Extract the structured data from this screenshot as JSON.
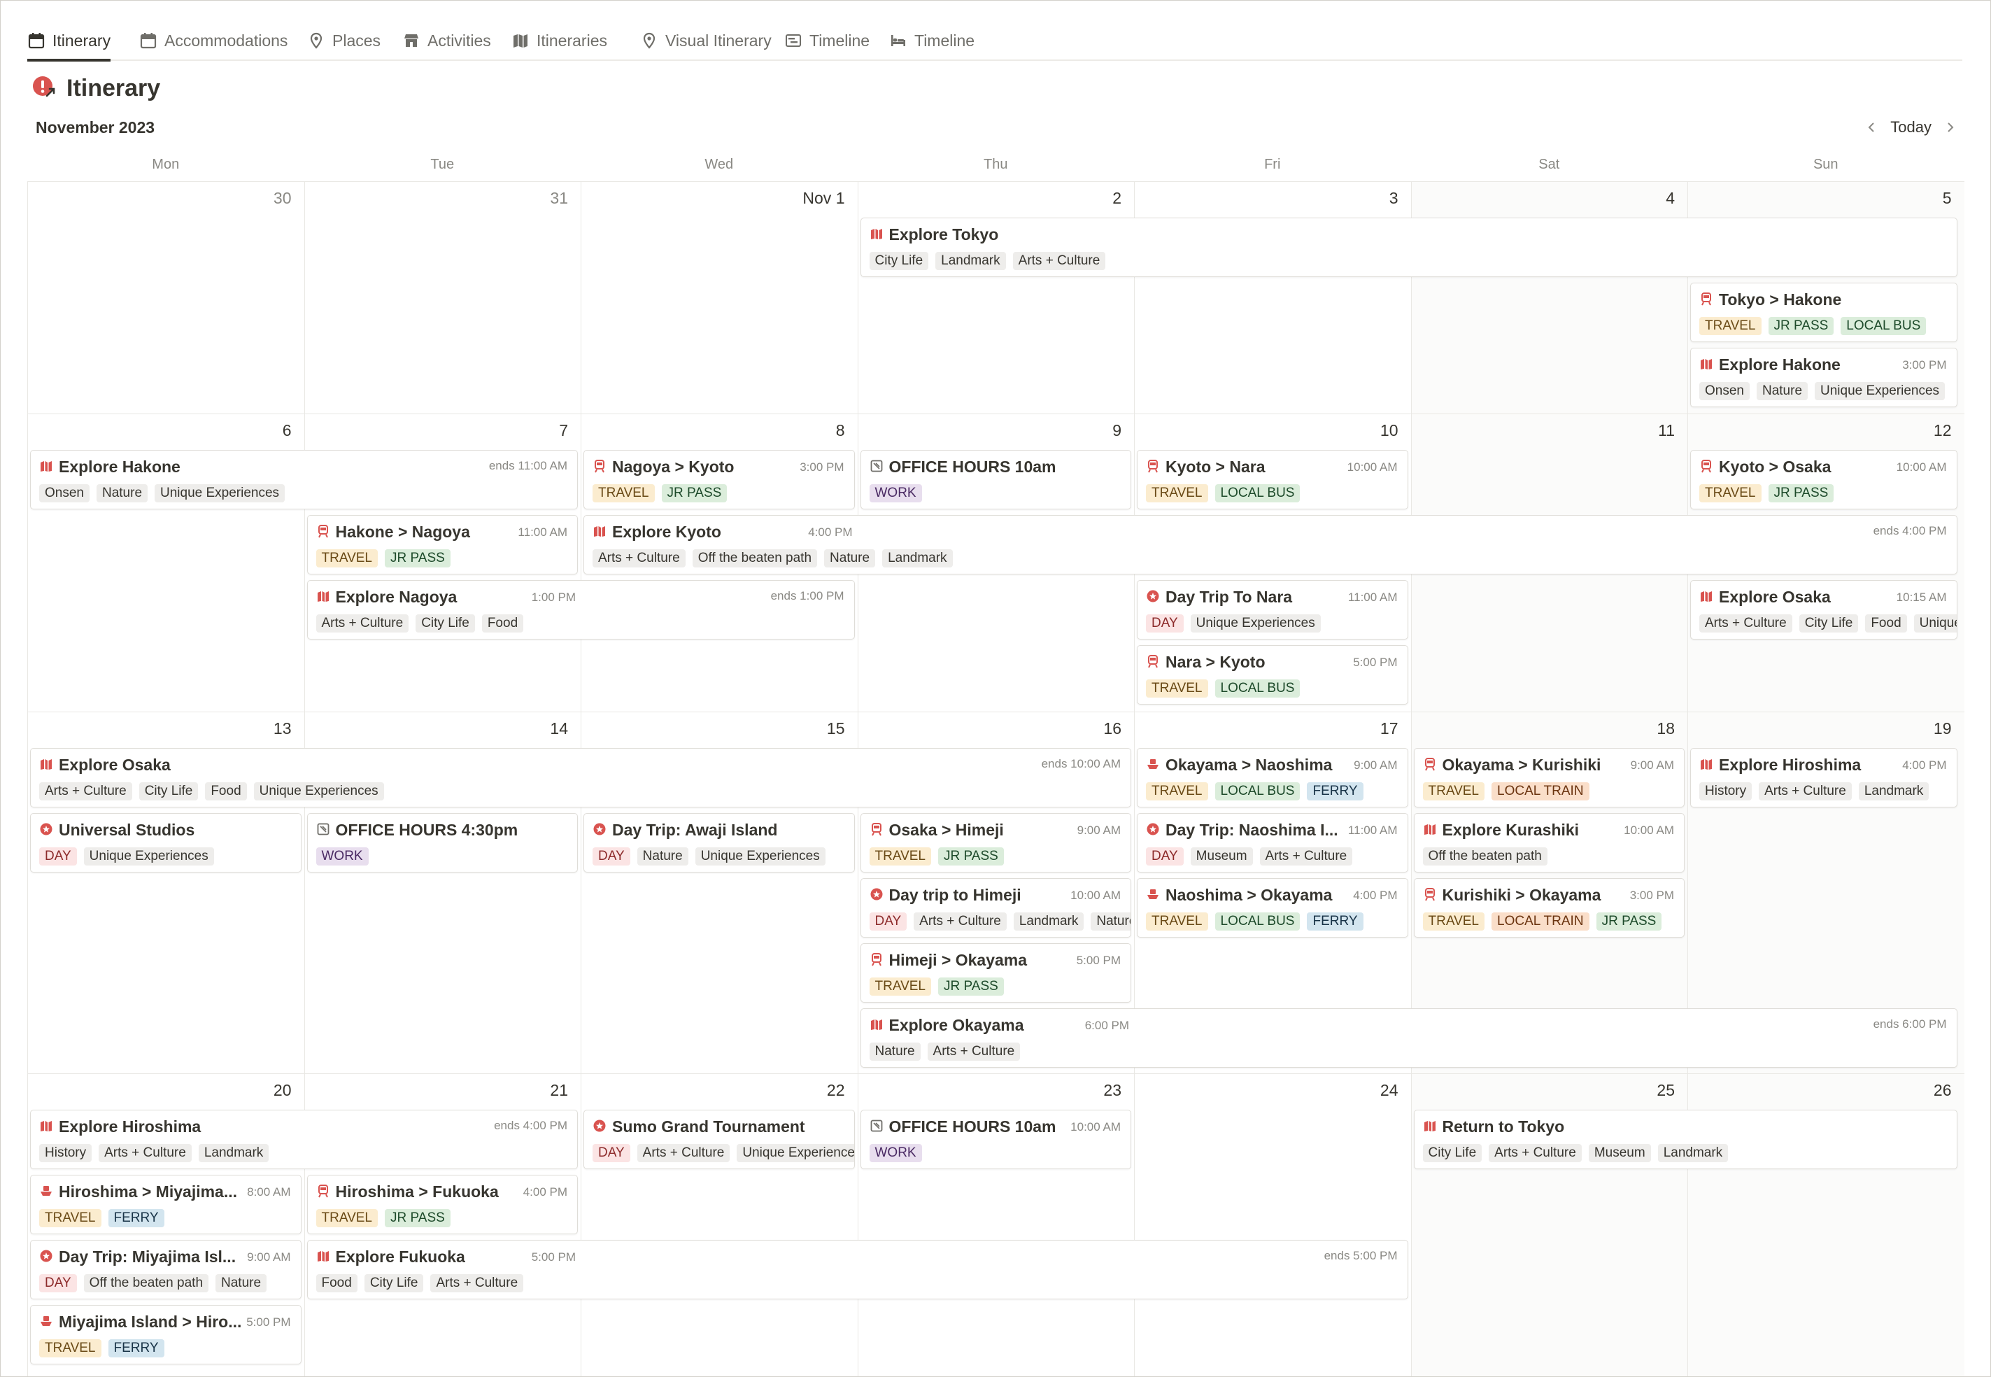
{
  "tabs": [
    {
      "label": "Itinerary",
      "icon": "calendar-icon",
      "active": true
    },
    {
      "label": "Accommodations",
      "icon": "calendar-icon",
      "active": false
    },
    {
      "label": "Places",
      "icon": "map-pin-icon",
      "active": false
    },
    {
      "label": "Activities",
      "icon": "store-icon",
      "active": false
    },
    {
      "label": "Itineraries",
      "icon": "map-icon",
      "active": false
    },
    {
      "label": "Visual Itinerary",
      "icon": "map-pin-icon",
      "active": false
    },
    {
      "label": "Timeline",
      "icon": "timeline-icon",
      "active": false
    },
    {
      "label": "Timeline",
      "icon": "bed-icon",
      "active": false
    }
  ],
  "page": {
    "title": "Itinerary",
    "icon": "info-alert-icon"
  },
  "calendar": {
    "month_label": "November 2023",
    "today_label": "Today",
    "weekdays": [
      "Mon",
      "Tue",
      "Wed",
      "Thu",
      "Fri",
      "Sat",
      "Sun"
    ],
    "weeks": [
      [
        "30",
        "31",
        "Nov 1",
        "2",
        "3",
        "4",
        "5"
      ],
      [
        "6",
        "7",
        "8",
        "9",
        "10",
        "11",
        "12"
      ],
      [
        "13",
        "14",
        "15",
        "16",
        "17",
        "18",
        "19"
      ],
      [
        "20",
        "21",
        "22",
        "23",
        "24",
        "25",
        "26"
      ]
    ],
    "events": [
      {
        "week": 0,
        "start": 3,
        "span": 4,
        "row": 0,
        "icon": "map-icon",
        "title": "Explore Tokyo",
        "time": "",
        "ends": "",
        "tags": [
          {
            "t": "City Life"
          },
          {
            "t": "Landmark"
          },
          {
            "t": "Arts + Culture"
          }
        ]
      },
      {
        "week": 0,
        "start": 6,
        "span": 1,
        "row": 1,
        "icon": "train-icon",
        "title": "Tokyo > Hakone",
        "time": "",
        "ends": "",
        "tags": [
          {
            "t": "TRAVEL",
            "c": "travel"
          },
          {
            "t": "JR PASS",
            "c": "green"
          },
          {
            "t": "LOCAL BUS",
            "c": "green"
          }
        ]
      },
      {
        "week": 0,
        "start": 6,
        "span": 1,
        "row": 2,
        "icon": "map-icon",
        "title": "Explore Hakone",
        "time": "3:00 PM",
        "ends": "",
        "tags": [
          {
            "t": "Onsen"
          },
          {
            "t": "Nature"
          },
          {
            "t": "Unique Experiences"
          }
        ]
      },
      {
        "week": 1,
        "start": 0,
        "span": 2,
        "row": 0,
        "icon": "map-icon",
        "title": "Explore Hakone",
        "time": "",
        "ends": "ends 11:00 AM",
        "tags": [
          {
            "t": "Onsen"
          },
          {
            "t": "Nature"
          },
          {
            "t": "Unique Experiences"
          }
        ]
      },
      {
        "week": 1,
        "start": 2,
        "span": 1,
        "row": 0,
        "icon": "train-icon",
        "title": "Nagoya > Kyoto",
        "time": "3:00 PM",
        "ends": "",
        "tags": [
          {
            "t": "TRAVEL",
            "c": "travel"
          },
          {
            "t": "JR PASS",
            "c": "green"
          }
        ]
      },
      {
        "week": 1,
        "start": 3,
        "span": 1,
        "row": 0,
        "icon": "calendar-square-icon",
        "title": "OFFICE HOURS 10am",
        "time": "",
        "ends": "",
        "tags": [
          {
            "t": "WORK",
            "c": "work"
          }
        ]
      },
      {
        "week": 1,
        "start": 4,
        "span": 1,
        "row": 0,
        "icon": "train-icon",
        "title": "Kyoto > Nara",
        "time": "10:00 AM",
        "ends": "",
        "tags": [
          {
            "t": "TRAVEL",
            "c": "travel"
          },
          {
            "t": "LOCAL BUS",
            "c": "green"
          }
        ]
      },
      {
        "week": 1,
        "start": 6,
        "span": 1,
        "row": 0,
        "icon": "train-icon",
        "title": "Kyoto > Osaka",
        "time": "10:00 AM",
        "ends": "",
        "tags": [
          {
            "t": "TRAVEL",
            "c": "travel"
          },
          {
            "t": "JR PASS",
            "c": "green"
          }
        ]
      },
      {
        "week": 1,
        "start": 1,
        "span": 1,
        "row": 1,
        "icon": "train-icon",
        "title": "Hakone > Nagoya",
        "time": "11:00 AM",
        "ends": "",
        "tags": [
          {
            "t": "TRAVEL",
            "c": "travel"
          },
          {
            "t": "JR PASS",
            "c": "green"
          }
        ]
      },
      {
        "week": 1,
        "start": 2,
        "span": 5,
        "row": 1,
        "icon": "map-icon",
        "title": "Explore Kyoto",
        "time": "4:00 PM",
        "ends": "ends 4:00 PM",
        "tags": [
          {
            "t": "Arts + Culture"
          },
          {
            "t": "Off the beaten path"
          },
          {
            "t": "Nature"
          },
          {
            "t": "Landmark"
          }
        ]
      },
      {
        "week": 1,
        "start": 1,
        "span": 2,
        "row": 2,
        "icon": "map-icon",
        "title": "Explore Nagoya",
        "time": "1:00 PM",
        "ends": "ends 1:00 PM",
        "tags": [
          {
            "t": "Arts + Culture"
          },
          {
            "t": "City Life"
          },
          {
            "t": "Food"
          }
        ]
      },
      {
        "week": 1,
        "start": 4,
        "span": 1,
        "row": 2,
        "icon": "star-badge-icon",
        "title": "Day Trip To Nara",
        "time": "11:00 AM",
        "ends": "",
        "tags": [
          {
            "t": "DAY",
            "c": "day"
          },
          {
            "t": "Unique Experiences"
          }
        ]
      },
      {
        "week": 1,
        "start": 6,
        "span": 1,
        "row": 2,
        "icon": "map-icon",
        "title": "Explore Osaka",
        "time": "10:15 AM",
        "ends": "",
        "tags": [
          {
            "t": "Arts + Culture"
          },
          {
            "t": "City Life"
          },
          {
            "t": "Food"
          },
          {
            "t": "Unique Experiences"
          }
        ]
      },
      {
        "week": 1,
        "start": 4,
        "span": 1,
        "row": 3,
        "icon": "train-icon",
        "title": "Nara > Kyoto",
        "time": "5:00 PM",
        "ends": "",
        "tags": [
          {
            "t": "TRAVEL",
            "c": "travel"
          },
          {
            "t": "LOCAL BUS",
            "c": "green"
          }
        ]
      },
      {
        "week": 2,
        "start": 0,
        "span": 4,
        "row": 0,
        "icon": "map-icon",
        "title": "Explore Osaka",
        "time": "",
        "ends": "ends 10:00 AM",
        "tags": [
          {
            "t": "Arts + Culture"
          },
          {
            "t": "City Life"
          },
          {
            "t": "Food"
          },
          {
            "t": "Unique Experiences"
          }
        ]
      },
      {
        "week": 2,
        "start": 4,
        "span": 1,
        "row": 0,
        "icon": "boat-icon",
        "title": "Okayama > Naoshima",
        "time": "9:00 AM",
        "ends": "",
        "tags": [
          {
            "t": "TRAVEL",
            "c": "travel"
          },
          {
            "t": "LOCAL BUS",
            "c": "green"
          },
          {
            "t": "FERRY",
            "c": "ferry"
          }
        ]
      },
      {
        "week": 2,
        "start": 5,
        "span": 1,
        "row": 0,
        "icon": "train-icon",
        "title": "Okayama > Kurishiki",
        "time": "9:00 AM",
        "ends": "",
        "tags": [
          {
            "t": "TRAVEL",
            "c": "travel"
          },
          {
            "t": "LOCAL TRAIN",
            "c": "train"
          }
        ]
      },
      {
        "week": 2,
        "start": 6,
        "span": 1,
        "row": 0,
        "icon": "map-icon",
        "title": "Explore Hiroshima",
        "time": "4:00 PM",
        "ends": "",
        "tags": [
          {
            "t": "History"
          },
          {
            "t": "Arts + Culture"
          },
          {
            "t": "Landmark"
          }
        ]
      },
      {
        "week": 2,
        "start": 0,
        "span": 1,
        "row": 1,
        "icon": "star-badge-icon",
        "title": "Universal Studios",
        "time": "",
        "ends": "",
        "tags": [
          {
            "t": "DAY",
            "c": "day"
          },
          {
            "t": "Unique Experiences"
          }
        ]
      },
      {
        "week": 2,
        "start": 1,
        "span": 1,
        "row": 1,
        "icon": "calendar-square-icon",
        "title": "OFFICE HOURS 4:30pm",
        "time": "",
        "ends": "",
        "tags": [
          {
            "t": "WORK",
            "c": "work"
          }
        ]
      },
      {
        "week": 2,
        "start": 2,
        "span": 1,
        "row": 1,
        "icon": "star-badge-icon",
        "title": "Day Trip: Awaji Island",
        "time": "",
        "ends": "",
        "tags": [
          {
            "t": "DAY",
            "c": "day"
          },
          {
            "t": "Nature"
          },
          {
            "t": "Unique Experiences"
          }
        ]
      },
      {
        "week": 2,
        "start": 3,
        "span": 1,
        "row": 1,
        "icon": "train-icon",
        "title": "Osaka > Himeji",
        "time": "9:00 AM",
        "ends": "",
        "tags": [
          {
            "t": "TRAVEL",
            "c": "travel"
          },
          {
            "t": "JR PASS",
            "c": "green"
          }
        ]
      },
      {
        "week": 2,
        "start": 4,
        "span": 1,
        "row": 1,
        "icon": "star-badge-icon",
        "title": "Day Trip: Naoshima I...",
        "time": "11:00 AM",
        "ends": "",
        "tags": [
          {
            "t": "DAY",
            "c": "day"
          },
          {
            "t": "Museum"
          },
          {
            "t": "Arts + Culture"
          }
        ]
      },
      {
        "week": 2,
        "start": 5,
        "span": 1,
        "row": 1,
        "icon": "map-icon",
        "title": "Explore Kurashiki",
        "time": "10:00 AM",
        "ends": "",
        "tags": [
          {
            "t": "Off the beaten path"
          }
        ]
      },
      {
        "week": 2,
        "start": 3,
        "span": 1,
        "row": 2,
        "icon": "star-badge-icon",
        "title": "Day trip to Himeji",
        "time": "10:00 AM",
        "ends": "",
        "tags": [
          {
            "t": "DAY",
            "c": "day"
          },
          {
            "t": "Arts + Culture"
          },
          {
            "t": "Landmark"
          },
          {
            "t": "Nature"
          }
        ]
      },
      {
        "week": 2,
        "start": 4,
        "span": 1,
        "row": 2,
        "icon": "boat-icon",
        "title": "Naoshima > Okayama",
        "time": "4:00 PM",
        "ends": "",
        "tags": [
          {
            "t": "TRAVEL",
            "c": "travel"
          },
          {
            "t": "LOCAL BUS",
            "c": "green"
          },
          {
            "t": "FERRY",
            "c": "ferry"
          }
        ]
      },
      {
        "week": 2,
        "start": 5,
        "span": 1,
        "row": 2,
        "icon": "train-icon",
        "title": "Kurishiki > Okayama",
        "time": "3:00 PM",
        "ends": "",
        "tags": [
          {
            "t": "TRAVEL",
            "c": "travel"
          },
          {
            "t": "LOCAL TRAIN",
            "c": "train"
          },
          {
            "t": "JR PASS",
            "c": "green"
          }
        ]
      },
      {
        "week": 2,
        "start": 3,
        "span": 1,
        "row": 3,
        "icon": "train-icon",
        "title": "Himeji > Okayama",
        "time": "5:00 PM",
        "ends": "",
        "tags": [
          {
            "t": "TRAVEL",
            "c": "travel"
          },
          {
            "t": "JR PASS",
            "c": "green"
          }
        ]
      },
      {
        "week": 2,
        "start": 3,
        "span": 4,
        "row": 4,
        "icon": "map-icon",
        "title": "Explore Okayama",
        "time": "6:00 PM",
        "ends": "ends 6:00 PM",
        "tags": [
          {
            "t": "Nature"
          },
          {
            "t": "Arts + Culture"
          }
        ]
      },
      {
        "week": 3,
        "start": 0,
        "span": 2,
        "row": 0,
        "icon": "map-icon",
        "title": "Explore Hiroshima",
        "time": "",
        "ends": "ends 4:00 PM",
        "tags": [
          {
            "t": "History"
          },
          {
            "t": "Arts + Culture"
          },
          {
            "t": "Landmark"
          }
        ]
      },
      {
        "week": 3,
        "start": 2,
        "span": 1,
        "row": 0,
        "icon": "star-badge-icon",
        "title": "Sumo Grand Tournament",
        "time": "",
        "ends": "",
        "tags": [
          {
            "t": "DAY",
            "c": "day"
          },
          {
            "t": "Arts + Culture"
          },
          {
            "t": "Unique Experiences"
          }
        ]
      },
      {
        "week": 3,
        "start": 3,
        "span": 1,
        "row": 0,
        "icon": "calendar-square-icon",
        "title": "OFFICE HOURS 10am",
        "time": "10:00 AM",
        "ends": "",
        "tags": [
          {
            "t": "WORK",
            "c": "work"
          }
        ]
      },
      {
        "week": 3,
        "start": 5,
        "span": 2,
        "row": 0,
        "icon": "map-icon",
        "title": "Return to Tokyo",
        "time": "",
        "ends": "",
        "tags": [
          {
            "t": "City Life"
          },
          {
            "t": "Arts + Culture"
          },
          {
            "t": "Museum"
          },
          {
            "t": "Landmark"
          }
        ]
      },
      {
        "week": 3,
        "start": 0,
        "span": 1,
        "row": 1,
        "icon": "boat-icon",
        "title": "Hiroshima > Miyajima...",
        "time": "8:00 AM",
        "ends": "",
        "tags": [
          {
            "t": "TRAVEL",
            "c": "travel"
          },
          {
            "t": "FERRY",
            "c": "ferry"
          }
        ]
      },
      {
        "week": 3,
        "start": 1,
        "span": 1,
        "row": 1,
        "icon": "train-icon",
        "title": "Hiroshima > Fukuoka",
        "time": "4:00 PM",
        "ends": "",
        "tags": [
          {
            "t": "TRAVEL",
            "c": "travel"
          },
          {
            "t": "JR PASS",
            "c": "green"
          }
        ]
      },
      {
        "week": 3,
        "start": 0,
        "span": 1,
        "row": 2,
        "icon": "star-badge-icon",
        "title": "Day Trip: Miyajima Isl...",
        "time": "9:00 AM",
        "ends": "",
        "tags": [
          {
            "t": "DAY",
            "c": "day"
          },
          {
            "t": "Off the beaten path"
          },
          {
            "t": "Nature"
          }
        ]
      },
      {
        "week": 3,
        "start": 1,
        "span": 4,
        "row": 2,
        "icon": "map-icon",
        "title": "Explore Fukuoka",
        "time": "5:00 PM",
        "ends": "ends 5:00 PM",
        "tags": [
          {
            "t": "Food"
          },
          {
            "t": "City Life"
          },
          {
            "t": "Arts + Culture"
          }
        ]
      },
      {
        "week": 3,
        "start": 0,
        "span": 1,
        "row": 3,
        "icon": "boat-icon",
        "title": "Miyajima Island > Hiro...",
        "time": "5:00 PM",
        "ends": "",
        "tags": [
          {
            "t": "TRAVEL",
            "c": "travel"
          },
          {
            "t": "FERRY",
            "c": "ferry"
          }
        ]
      }
    ]
  },
  "colors": {
    "accent_red": "#d9534f",
    "text": "#37352f",
    "muted": "#8a8984"
  }
}
